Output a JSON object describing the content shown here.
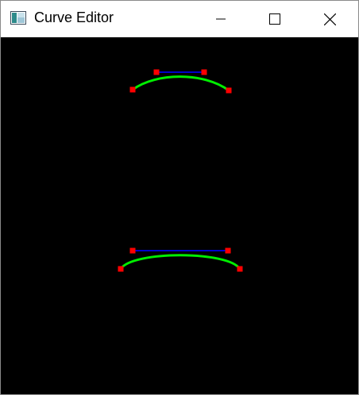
{
  "window": {
    "title": "Curve Editor",
    "icon": "app-window-icon",
    "controls": {
      "minimize_icon": "minimize-icon",
      "maximize_icon": "maximize-icon",
      "close_icon": "close-icon"
    }
  },
  "canvas": {
    "background": "#000000",
    "curve_color": "#00ee00",
    "control_line_color": "#0000cc",
    "handle_color": "#ff0000",
    "curves": [
      {
        "name": "top-curve",
        "points": [
          [
            166,
            112
          ],
          [
            196,
            90
          ],
          [
            256,
            90
          ],
          [
            287,
            113
          ]
        ]
      },
      {
        "name": "bottom-curve",
        "points": [
          [
            151,
            338
          ],
          [
            166,
            315
          ],
          [
            286,
            315
          ],
          [
            301,
            338
          ]
        ]
      }
    ]
  }
}
